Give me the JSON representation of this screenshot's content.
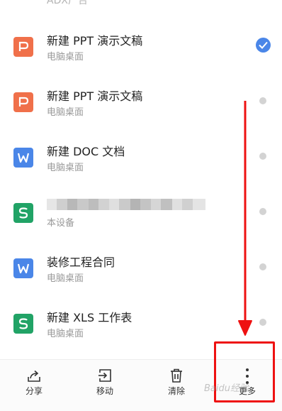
{
  "file_list": {
    "top_partial_text": "ADX广告",
    "items": [
      {
        "title": "新建 PPT 演示文稿",
        "subtitle": "电脑桌面",
        "type": "ppt",
        "icon": "ppt-file-icon",
        "selected": true
      },
      {
        "title": "新建 PPT 演示文稿",
        "subtitle": "电脑桌面",
        "type": "ppt",
        "icon": "ppt-file-icon",
        "selected": false
      },
      {
        "title": "新建 DOC 文档",
        "subtitle": "电脑桌面",
        "type": "doc",
        "icon": "doc-file-icon",
        "selected": false
      },
      {
        "title": "",
        "subtitle": "本设备",
        "type": "xls",
        "icon": "xls-file-icon",
        "selected": false,
        "title_obscured": true
      },
      {
        "title": "装修工程合同",
        "subtitle": "电脑桌面",
        "type": "doc",
        "icon": "doc-file-icon",
        "selected": false
      },
      {
        "title": "新建 XLS 工作表",
        "subtitle": "电脑桌面",
        "type": "xls",
        "icon": "xls-file-icon",
        "selected": false
      }
    ]
  },
  "toolbar": {
    "share_label": "分享",
    "move_label": "移动",
    "delete_label": "清除",
    "more_label": "更多",
    "share_icon": "share-icon",
    "move_icon": "move-icon",
    "delete_icon": "trash-icon",
    "more_icon": "more-vertical-icon"
  },
  "watermark": "Baidu经验",
  "colors": {
    "ppt": "#f0704a",
    "doc": "#4a86e8",
    "xls": "#21a366",
    "selected": "#4a86e8",
    "annotation": "#ee1111"
  }
}
